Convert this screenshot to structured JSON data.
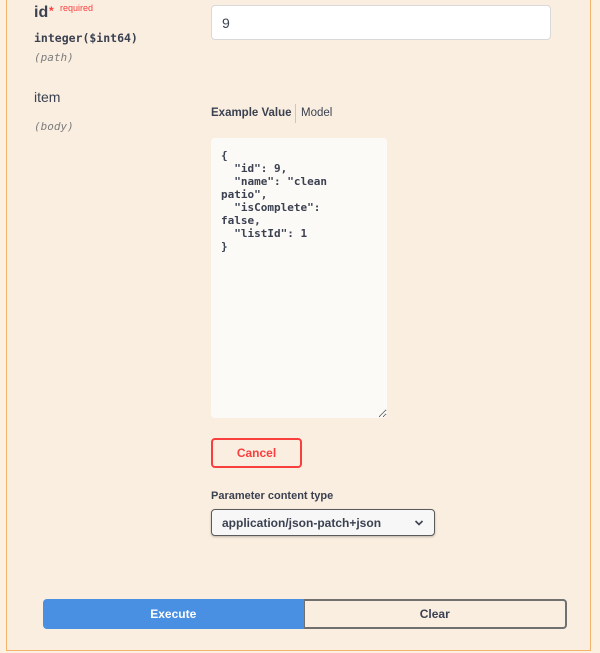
{
  "parameters": {
    "id": {
      "name": "id",
      "required_marker": "*",
      "required_label": "required",
      "type": "integer($int64)",
      "location": "(path)",
      "value": "9"
    },
    "item": {
      "name": "item",
      "location": "(body)",
      "tabs": {
        "example_value": "Example Value",
        "model": "Model"
      },
      "body_value": "{\n  \"id\": 9,\n  \"name\": \"clean\npatio\",\n  \"isComplete\":\nfalse,\n  \"listId\": 1\n}"
    }
  },
  "cancel_label": "Cancel",
  "content_type": {
    "label": "Parameter content type",
    "selected": "application/json-patch+json"
  },
  "actions": {
    "execute_label": "Execute",
    "clear_label": "Clear"
  },
  "icons": {
    "select_chevron": "chevron-down-icon"
  },
  "colors": {
    "accent_orange_border": "#f5b36d",
    "required_red": "#f93e3e",
    "execute_blue": "#4990e2",
    "panel_bg": "#faeee0"
  }
}
